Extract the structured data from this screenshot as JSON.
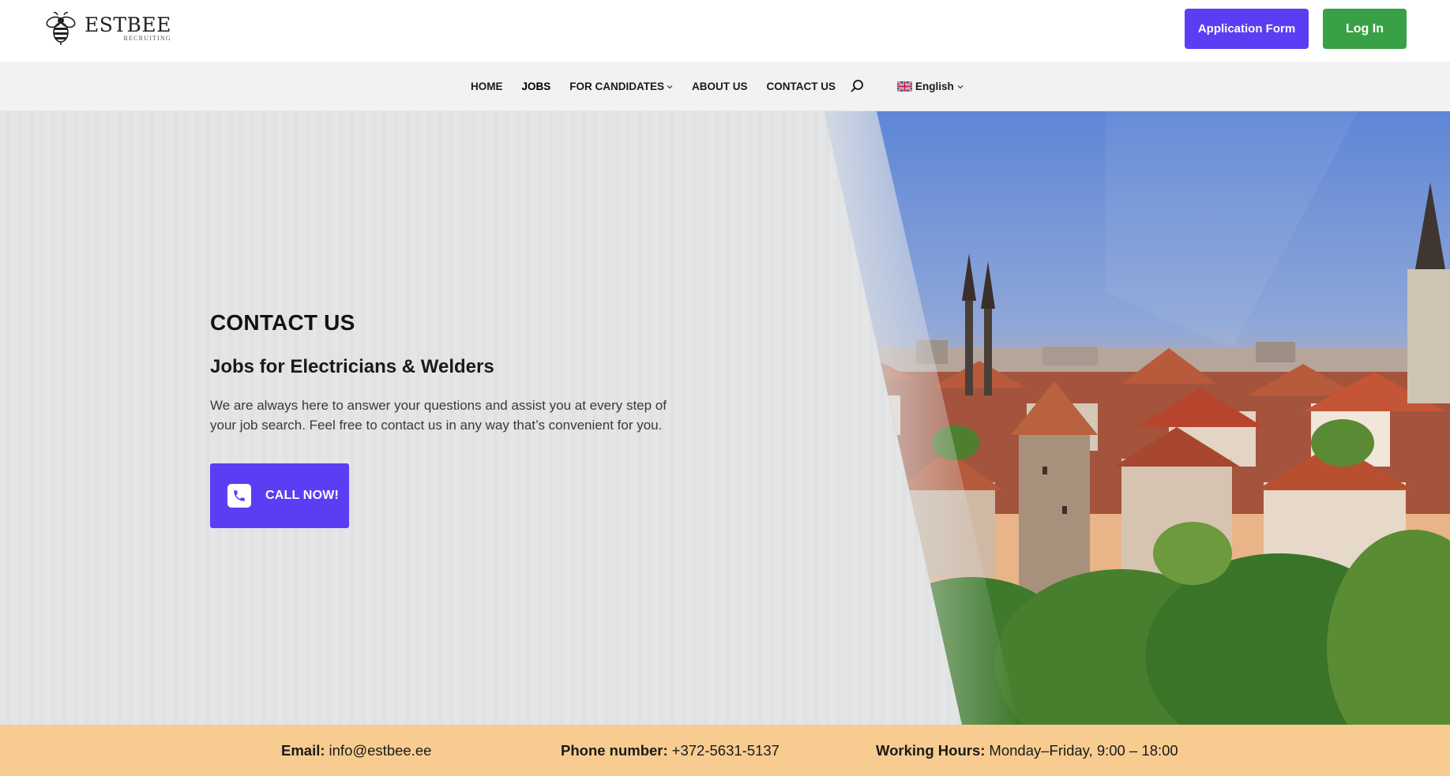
{
  "header": {
    "logo": {
      "name": "ESTBEE",
      "tagline": "RECRUITING"
    },
    "application_button": "Application Form",
    "login_button": "Log In",
    "colors": {
      "application_button": "#5b3ef3",
      "login_button": "#3aa046"
    }
  },
  "nav": {
    "items": [
      {
        "label": "HOME",
        "active": false,
        "dropdown": false
      },
      {
        "label": "JOBS",
        "active": true,
        "dropdown": false
      },
      {
        "label": "FOR CANDIDATES",
        "active": false,
        "dropdown": true
      },
      {
        "label": "ABOUT US",
        "active": false,
        "dropdown": false
      },
      {
        "label": "CONTACT US",
        "active": false,
        "dropdown": false
      }
    ],
    "search_icon": "search-icon",
    "language": {
      "flag_icon": "uk-flag-icon",
      "label": "English"
    }
  },
  "hero": {
    "title": "CONTACT US",
    "subtitle": "Jobs for Electricians & Welders",
    "text": "We are always here to answer your questions and assist you at every step of your job search. Feel free to contact us in any way that’s convenient for you.",
    "call_button": "CALL NOW!",
    "call_icon": "phone-icon",
    "image_icon": "tallinn-old-town-photo"
  },
  "contact_bar": {
    "email_label": "Email:",
    "email_value": "info@estbee.ee",
    "phone_label": "Phone number:",
    "phone_value": "+372-5631-5137",
    "hours_label": "Working Hours:",
    "hours_value": "Monday–Friday, 9:00 – 18:00",
    "background_color": "#f8cc90"
  }
}
